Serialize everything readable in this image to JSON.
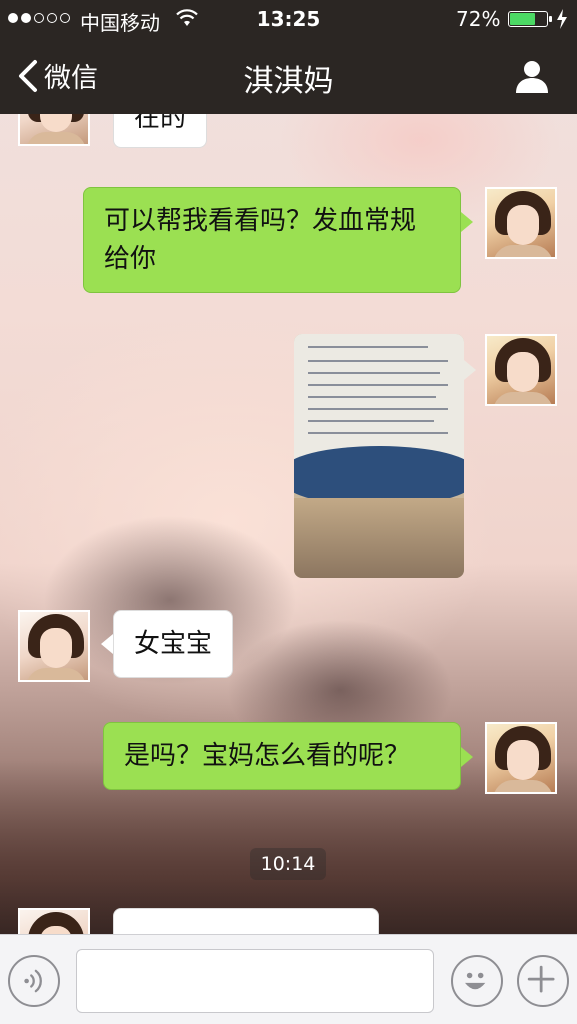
{
  "status_bar": {
    "carrier": "中国移动",
    "time": "13:25",
    "battery_percent": "72%",
    "battery_level": 0.72,
    "signal_bars_filled": 2,
    "signal_bars_total": 5
  },
  "nav": {
    "back_label": "微信",
    "title": "淇淇妈",
    "profile_icon": "person-icon"
  },
  "messages": [
    {
      "sender": "her",
      "type": "text",
      "text": "在的"
    },
    {
      "sender": "me",
      "type": "text",
      "text": "可以帮我看看吗？发血常规给你"
    },
    {
      "sender": "me",
      "type": "image"
    },
    {
      "sender": "her",
      "type": "text",
      "text": "女宝宝"
    },
    {
      "sender": "me",
      "type": "text",
      "text": "是吗？宝妈怎么看的呢？"
    },
    {
      "type": "timestamp",
      "text": "10:14"
    },
    {
      "sender": "her",
      "type": "text",
      "text": ""
    }
  ],
  "input_bar": {
    "voice_icon": "voice-icon",
    "emoji_icon": "emoji-icon",
    "plus_icon": "plus-icon",
    "input_value": ""
  },
  "colors": {
    "bar_background": "#2b2623",
    "outgoing_bubble": "#9be052",
    "incoming_bubble": "#ffffff",
    "battery_fill": "#4cd964"
  }
}
